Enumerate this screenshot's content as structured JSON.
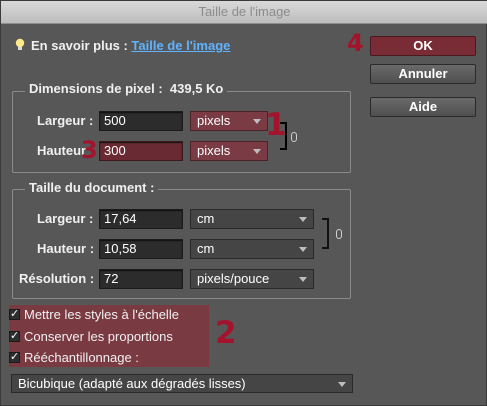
{
  "window": {
    "title": "Taille de l'image"
  },
  "info": {
    "prefix": "En savoir plus : ",
    "link": "Taille de l'image"
  },
  "buttons": {
    "ok": "OK",
    "cancel": "Annuler",
    "help": "Aide"
  },
  "pixel_dims": {
    "title": "Dimensions de pixel :",
    "size": "439,5 Ko",
    "width_label": "Largeur :",
    "width_value": "500",
    "width_unit": "pixels",
    "height_label": "Hauteur :",
    "height_value": "300",
    "height_unit": "pixels"
  },
  "doc_size": {
    "title": "Taille du document :",
    "width_label": "Largeur :",
    "width_value": "17,64",
    "width_unit": "cm",
    "height_label": "Hauteur :",
    "height_value": "10,58",
    "height_unit": "cm",
    "res_label": "Résolution :",
    "res_value": "72",
    "res_unit": "pixels/pouce"
  },
  "options": {
    "scale_styles": {
      "label": "Mettre les styles à l'échelle",
      "checked": true
    },
    "constrain": {
      "label": "Conserver les proportions",
      "checked": true
    },
    "resample": {
      "label": "Rééchantillonnage :",
      "checked": true
    }
  },
  "resample_method": "Bicubique (adapté aux dégradés lisses)",
  "annotations": {
    "a1": "1",
    "a2": "2",
    "a3": "3",
    "a4": "4"
  },
  "colors": {
    "highlight": "#7a3a42",
    "annotation": "#a3142c",
    "link": "#5fb3ff"
  }
}
